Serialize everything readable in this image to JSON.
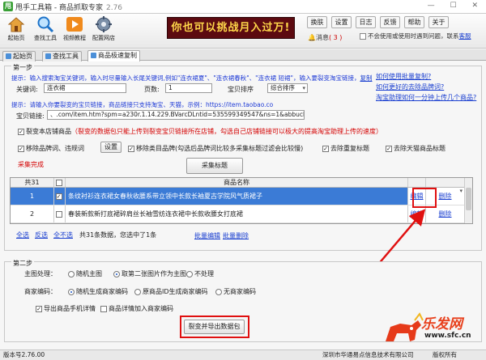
{
  "window": {
    "title": "甩手工具箱 - 商品抓取专家",
    "version": "2.76",
    "logo_char": "甩",
    "controls": "— ☐ ✕"
  },
  "toolbar": {
    "items": [
      {
        "label": "起始页",
        "icon": "home-icon"
      },
      {
        "label": "查找工具",
        "icon": "search-icon"
      },
      {
        "label": "视频教程",
        "icon": "play-icon"
      },
      {
        "label": "配置网店",
        "icon": "settings-icon"
      }
    ],
    "banner": "你也可以挑战月入过万!",
    "buttons": [
      "换肤",
      "设置",
      "日志",
      "反馈",
      "帮助",
      "关于"
    ],
    "message_label": "消息",
    "message_count": "( 3 )",
    "autostart_label": "不会使用或使用时遇到问题，联系",
    "autostart_link": "客服"
  },
  "tabs": [
    "起始页",
    "查找工具",
    "商品极速复制"
  ],
  "step1": {
    "legend": "第一步",
    "tip1": "提示：输入搜索淘宝关键词，输入时尽量输入长尾关键词,例如\"连衣裙夏\"、\"连衣裙春秋\"、\"连衣裙 短裙\"，输入要裂变淘宝链接，",
    "tip1_link": "复制",
    "help_links": [
      "如何使用批量复制?",
      "如何更好的去除品牌词?",
      "淘宝助理如何一分钟上传几个商品?"
    ],
    "keyword_label": "关键词:",
    "keyword_value": "连衣裙",
    "pages_label": "页数:",
    "pages_value": "1",
    "sort_label": "宝贝排序",
    "sort_value": "综合排序",
    "tip2": "提示：请输入你要裂变的宝贝链接，商品链接只支持淘宝、天猫，示例：https://item.taobao.co",
    "link_label": "宝贝链接:",
    "link_value": "、.com/item.htm?spm=a230r.1.14.229.BVarcDLntid=535599349547&ns=1&abbucket=19#detail",
    "fission_label": "裂变本店铺商品",
    "fission_note": "（裂变的数据包只能上传到裂变宝贝链接所在店铺，勾选自己店铺链接可以极大的提高淘宝助理上传的速度）",
    "remove_brand_label": "移除品牌词、违规词",
    "settings_button": "设置",
    "remove_category_label": "移除类目品牌(勾选后品牌词比较多采集标题过滤会比较慢)",
    "dedupe_label": "去除重复标题",
    "tmall_label": "去除天猫商品标题",
    "status": "采集完成",
    "collect_button": "采集标题",
    "table": {
      "count_header": "共31",
      "name_header": "商品名称",
      "rows": [
        {
          "index": "1",
          "name": "条纹衬衫连衣裙女春秋收腰系带立领中长款长袖夏古学院风气质裙子",
          "edit": "编辑",
          "delete": "删除",
          "checked": true
        },
        {
          "index": "2",
          "name": "春装新款新打底裙碎肩丝长袖雪纺连衣裙中长款收腰女打底裙",
          "edit": "编辑",
          "delete": "删除",
          "checked": false
        }
      ]
    },
    "select_all": "全选",
    "invert": "反选",
    "select_none": "全不选",
    "summary": "共31条数据，您选中了1条",
    "batch_edit": "批量编辑",
    "batch_delete": "批量删除"
  },
  "step2": {
    "legend": "第二步",
    "main_image_label": "主图处理：",
    "main_image_options": [
      "随机主图",
      "取第二张图片作为主图",
      "不处理"
    ],
    "code_label": "商家编码：",
    "code_options": [
      "随机生成商家编码",
      "原商品ID生成商家编码",
      "无商家编码"
    ],
    "export_detail": "导出商品手机详情",
    "add_code_title": "商品详情加入商家编码",
    "export_button": "裂变并导出数据包"
  },
  "statusbar": {
    "version": "版本号2.76.00",
    "company": "深圳市华通易点信息技术有限公司",
    "copyright": "版权所有"
  },
  "watermark": {
    "text": "乐发网",
    "url": "www.sfc.cn"
  },
  "colors": {
    "highlight_red": "#e01010",
    "link_blue": "#1a3fd0",
    "selection_blue": "#3b7bd6",
    "banner_bg": "#5c0a10",
    "banner_text": "#ffd84a"
  }
}
